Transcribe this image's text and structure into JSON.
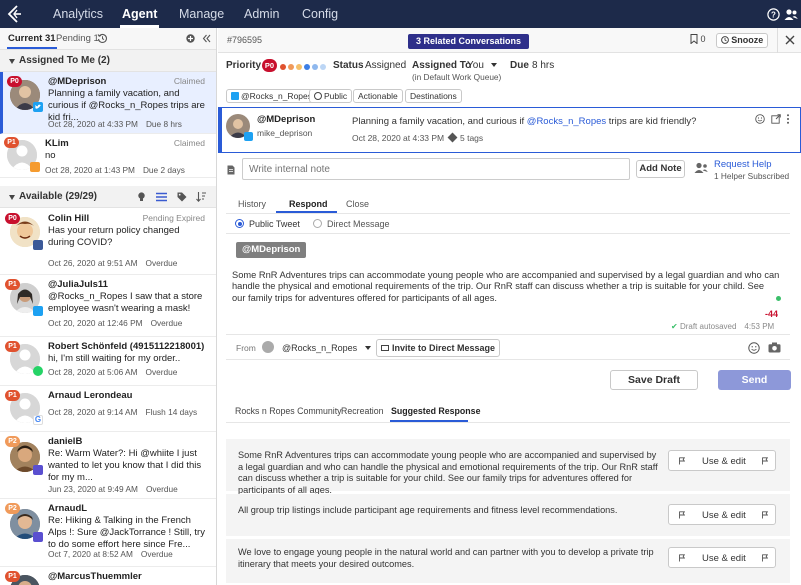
{
  "nav": {
    "items": [
      {
        "label": "Analytics"
      },
      {
        "label": "Agent"
      },
      {
        "label": "Manage"
      },
      {
        "label": "Admin"
      },
      {
        "label": "Config"
      }
    ],
    "active": "Agent"
  },
  "left": {
    "tabs": {
      "current": "Current 31",
      "pending": "Pending 1"
    },
    "assigned": {
      "title": "Assigned To Me (2)",
      "items": [
        {
          "name": "@MDeprison",
          "status": "Claimed",
          "priority": "P0",
          "network": "twitter",
          "text": "Planning a family vacation, and curious if @Rocks_n_Ropes trips are kid fri...",
          "time": "Oct 28, 2020 at 4:33 PM",
          "extra": "Due 8 hrs"
        },
        {
          "name": "KLim",
          "status": "Claimed",
          "priority": "P1",
          "network": "email",
          "text": "no",
          "time": "Oct 28, 2020 at 1:43 PM",
          "extra": "Due 2 days"
        }
      ]
    },
    "available": {
      "title": "Available (29/29)",
      "items": [
        {
          "name": "Colin Hill",
          "status": "Pending Expired",
          "priority": "P0",
          "network": "facebook",
          "text": "Has your return policy changed during COVID?",
          "time": "Oct 26, 2020 at 9:51 AM",
          "extra": "Overdue"
        },
        {
          "name": "@JuliaJuls11",
          "status": "",
          "priority": "P1",
          "network": "twitter",
          "text": "@Rocks_n_Ropes I saw that a store employee wasn't wearing a mask!",
          "time": "Oct 20, 2020 at 12:46 PM",
          "extra": "Overdue"
        },
        {
          "name": "Robert Schönfeld (4915112218001)",
          "status": "",
          "priority": "P1",
          "network": "whatsapp",
          "text": "hi, I'm still waiting for my order..",
          "time": "Oct 28, 2020 at 5:06 AM",
          "extra": "Overdue"
        },
        {
          "name": "Arnaud Lerondeau",
          "status": "",
          "priority": "P1",
          "network": "google",
          "text": "",
          "time": "Oct 28, 2020 at 9:14 AM",
          "extra": "Flush 14 days"
        },
        {
          "name": "danielB",
          "status": "",
          "priority": "P2",
          "network": "community",
          "text": "Re: Warm Water?: Hi @whiite I just wanted to let you know that I did this for my m...",
          "time": "Jun 23, 2020 at 9:49 AM",
          "extra": "Overdue"
        },
        {
          "name": "ArnaudL",
          "status": "",
          "priority": "P2",
          "network": "community",
          "text": "Re: Hiking & Talking in the French Alps !: Sure @JackTorrance ! Still, try to do some effort here since Fre...",
          "time": "Oct 7, 2020 at 8:52 AM",
          "extra": "Overdue"
        },
        {
          "name": "@MarcusThuemmler",
          "status": "",
          "priority": "P1",
          "network": "twitter",
          "text": "",
          "time": "",
          "extra": ""
        }
      ]
    }
  },
  "ticket": {
    "id": "#796595",
    "related": "3 Related Conversations",
    "bookmark_count": "0",
    "snooze": "Snooze",
    "priority_label": "Priority",
    "priority_badge": "P0",
    "status_label": "Status",
    "status_value": "Assigned",
    "assigned_label": "Assigned To",
    "assigned_value": "You",
    "assigned_sub": "(in Default Work Queue)",
    "due_label": "Due",
    "due_value": "8 hrs",
    "tags": [
      "@Rocks_n_Ropes",
      "Public",
      "Actionable",
      "Destinations"
    ]
  },
  "message": {
    "author": "@MDeprison",
    "handle": "mike_deprison",
    "text_before": "Planning a family vacation, and curious if ",
    "mention": "@Rocks_n_Ropes",
    "text_after": " trips are kid friendly?",
    "time": "Oct 28, 2020 at 4:33 PM",
    "tags": "5 tags"
  },
  "note": {
    "placeholder": "Write internal note",
    "add_label": "Add Note",
    "request_help": "Request Help",
    "helpers": "1 Helper Subscribed"
  },
  "respond_tabs": [
    "History",
    "Respond",
    "Close"
  ],
  "reply": {
    "type_public": "Public Tweet",
    "type_dm": "Direct Message",
    "mention": "@MDeprison",
    "text": "Some RnR Adventures trips can accommodate young people who are accompanied and supervised by a legal guardian and who can handle the physical and emotional requirements of the trip. Our RnR staff can discuss whether a trip is suitable for your child. See our family trips for adventures offered for participants of all ages.",
    "counter": "-44",
    "draft": "Draft autosaved",
    "draft_time": "4:53 PM",
    "from_label": "From",
    "from_account": "@Rocks_n_Ropes",
    "invite_dm": "Invite to Direct Message",
    "save_draft": "Save Draft",
    "send": "Send"
  },
  "kb_tabs": [
    "Rocks n Ropes Community",
    "Recreation",
    "Suggested Response"
  ],
  "suggestions": [
    {
      "text": "Some RnR Adventures trips can accommodate young people who are accompanied and supervised by a legal guardian and who can handle the physical and emotional requirements of the trip. Our RnR staff can discuss whether a trip is suitable for your child. See our family trips for adventures offered for participants of all ages.",
      "button": "Use & edit"
    },
    {
      "text": "All group trip listings include participant age requirements and fitness level recommendations.",
      "button": "Use & edit"
    },
    {
      "text": "We love to engage young people in the natural world and can partner with you to develop a private trip itinerary that meets your desired outcomes.",
      "button": "Use & edit"
    }
  ],
  "colors": {
    "topbar": "#1d2a4a",
    "accent": "#2a5bd7",
    "related": "#2e2f8a",
    "send": "#8d98d9",
    "p0": "#c8102e",
    "p1": "#e0522f"
  }
}
